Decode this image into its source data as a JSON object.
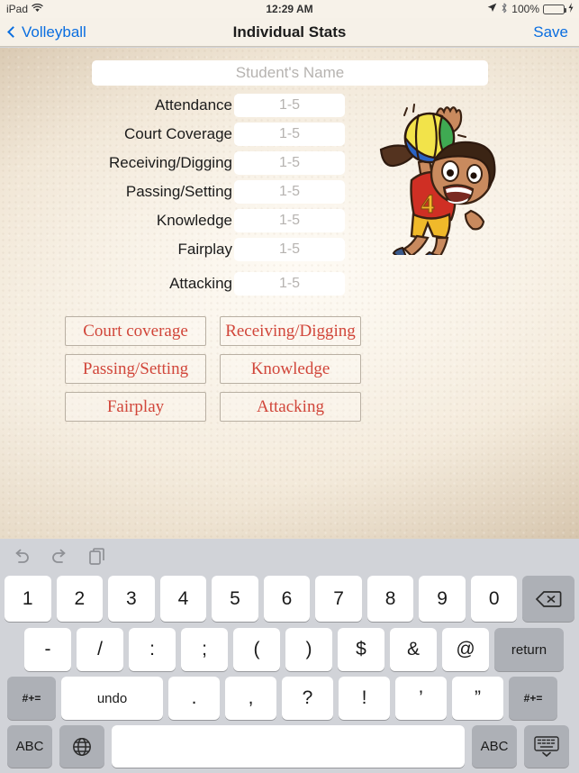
{
  "status_bar": {
    "device": "iPad",
    "wifi_icon": "wifi-icon",
    "time": "12:29 AM",
    "location_icon": "location-arrow-icon",
    "bluetooth_icon": "bluetooth-icon",
    "battery_percent": "100%",
    "battery_color": "#4cd04c"
  },
  "nav_bar": {
    "back_label": "Volleyball",
    "title": "Individual Stats",
    "save_label": "Save",
    "tint_color": "#0a6ee0"
  },
  "form": {
    "name_placeholder": "Student's Name",
    "name_value": "",
    "rating_placeholder": "1-5",
    "rows": [
      {
        "label": "Attendance",
        "value": ""
      },
      {
        "label": "Court Coverage",
        "value": ""
      },
      {
        "label": "Receiving/Digging",
        "value": ""
      },
      {
        "label": "Passing/Setting",
        "value": ""
      },
      {
        "label": "Knowledge",
        "value": ""
      },
      {
        "label": "Fairplay",
        "value": ""
      },
      {
        "label": "Attacking",
        "value": ""
      }
    ]
  },
  "illustration": {
    "name": "volleyball-player-icon",
    "jersey_number": "4",
    "jersey_color": "#cf2f24",
    "shorts_color": "#f0b92a"
  },
  "category_buttons": {
    "accent_color": "#d1463a",
    "items": [
      "Court coverage",
      "Receiving/Digging",
      "Passing/Setting",
      "Knowledge",
      "Fairplay",
      "Attacking"
    ]
  },
  "keyboard": {
    "toolbar": [
      {
        "name": "undo-icon"
      },
      {
        "name": "redo-icon"
      },
      {
        "name": "paste-icon"
      }
    ],
    "row_numbers": [
      "1",
      "2",
      "3",
      "4",
      "5",
      "6",
      "7",
      "8",
      "9",
      "0"
    ],
    "backspace_label": "",
    "row_symbols": [
      "-",
      "/",
      ":",
      ";",
      "(",
      ")",
      "$",
      "&",
      "@"
    ],
    "return_label": "return",
    "row_punct_left": "#+=",
    "undo_key_label": "undo",
    "row_punct": [
      ".",
      ",",
      "?",
      "!",
      "’",
      "”"
    ],
    "row_punct_right": "#+=",
    "abc_left_label": "ABC",
    "globe_label": "globe-icon",
    "space_label": "",
    "abc_right_label": "ABC",
    "dismiss_label": "dismiss-keyboard-icon"
  }
}
